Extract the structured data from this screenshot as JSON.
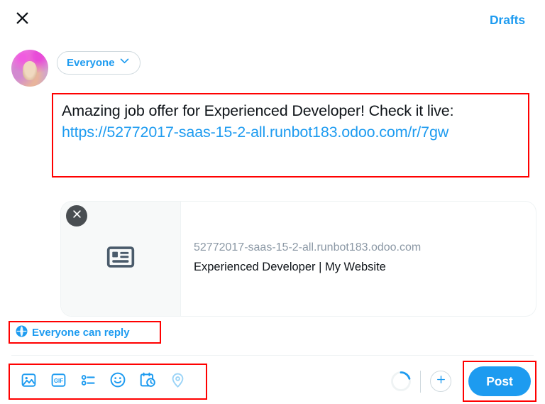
{
  "header": {
    "close_label": "close-icon",
    "drafts_label": "Drafts"
  },
  "composer": {
    "avatar_alt": "user-avatar",
    "audience": {
      "label": "Everyone",
      "chevron": "chevron-down-icon"
    },
    "text_before_link": "Amazing job offer for Experienced Developer! Check it live: ",
    "link_text": "https://52772017-saas-15-2-all.runbot183.odoo.com/r/7gw"
  },
  "link_card": {
    "remove_label": "close-icon",
    "thumbnail_icon": "article-icon",
    "domain": "52772017-saas-15-2-all.runbot183.odoo.com",
    "title": "Experienced Developer | My Website"
  },
  "reply_scope": {
    "icon": "globe-icon",
    "label": "Everyone can reply"
  },
  "toolbar": {
    "items": [
      {
        "name": "media-button",
        "icon": "image-icon",
        "label": "Media",
        "enabled": true
      },
      {
        "name": "gif-button",
        "icon": "gif-icon",
        "label": "GIF",
        "enabled": true
      },
      {
        "name": "poll-button",
        "icon": "poll-icon",
        "label": "Poll",
        "enabled": true
      },
      {
        "name": "emoji-button",
        "icon": "emoji-icon",
        "label": "Emoji",
        "enabled": true
      },
      {
        "name": "schedule-button",
        "icon": "schedule-icon",
        "label": "Schedule",
        "enabled": true
      },
      {
        "name": "location-button",
        "icon": "location-icon",
        "label": "Location",
        "enabled": false
      }
    ],
    "char_progress_percent": 20,
    "add_post_label": "+",
    "post_label": "Post"
  },
  "colors": {
    "accent": "#1d9bf0",
    "accent_disabled": "#9bd4f7",
    "text": "#0f1419",
    "muted": "#8b98a5",
    "border": "#cfd9de",
    "card_border": "#eff3f4",
    "thumb_bg": "#f7f9f9",
    "thumb_icon": "#4a5b6b",
    "highlight": "#ff0000"
  }
}
